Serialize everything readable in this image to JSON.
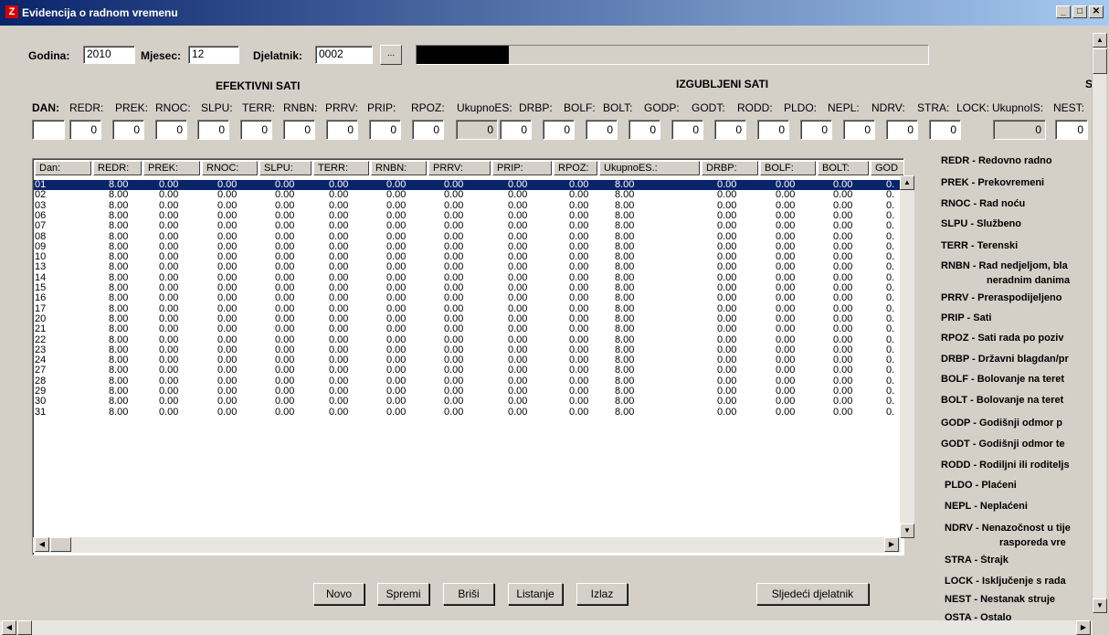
{
  "window": {
    "title": "Evidencija o radnom vremenu",
    "app_icon": "Z"
  },
  "form": {
    "godina_label": "Godina:",
    "godina": "2010",
    "mjesec_label": "Mjesec:",
    "mjesec": "12",
    "djelatnik_label": "Djelatnik:",
    "djelatnik": "0002",
    "browse_label": "...",
    "progress_fraction": 0.18
  },
  "sections": {
    "efektivni": "EFEKTIVNI SATI",
    "izgubljeni": "IZGUBLJENI SATI",
    "third": "S"
  },
  "headers": [
    "DAN:",
    "REDR:",
    "PREK:",
    "RNOC:",
    "SLPU:",
    "TERR:",
    "RNBN:",
    "PRRV:",
    "PRIP:",
    "RPOZ:",
    "UkupnoES:",
    "DRBP:",
    "BOLF:",
    "BOLT:",
    "GODP:",
    "GODT:",
    "RODD:",
    "PLDO:",
    "NEPL:",
    "NDRV:",
    "STRA:",
    "LOCK:",
    "UkupnoIS:",
    "NEST:"
  ],
  "entry_values": [
    "",
    "0",
    "0",
    "0",
    "0",
    "0",
    "0",
    "0",
    "0",
    "0",
    "0",
    "0",
    "0",
    "0",
    "0",
    "0",
    "0",
    "0",
    "0",
    "0",
    "0",
    "0",
    "0",
    "0"
  ],
  "grid": {
    "columns": [
      "Dan:",
      "REDR:",
      "PREK:",
      "RNOC:",
      "SLPU:",
      "TERR:",
      "RNBN:",
      "PRRV:",
      "PRIP:",
      "RPOZ:",
      "UkupnoES.:",
      "DRBP:",
      "BOLF:",
      "BOLT:",
      "GOD"
    ],
    "rows": [
      [
        "01",
        "8.00",
        "0.00",
        "0.00",
        "0.00",
        "0.00",
        "0.00",
        "0.00",
        "0.00",
        "0.00",
        "8.00",
        "0.00",
        "0.00",
        "0.00",
        "0."
      ],
      [
        "02",
        "8.00",
        "0.00",
        "0.00",
        "0.00",
        "0.00",
        "0.00",
        "0.00",
        "0.00",
        "0.00",
        "8.00",
        "0.00",
        "0.00",
        "0.00",
        "0."
      ],
      [
        "03",
        "8.00",
        "0.00",
        "0.00",
        "0.00",
        "0.00",
        "0.00",
        "0.00",
        "0.00",
        "0.00",
        "8.00",
        "0.00",
        "0.00",
        "0.00",
        "0."
      ],
      [
        "06",
        "8.00",
        "0.00",
        "0.00",
        "0.00",
        "0.00",
        "0.00",
        "0.00",
        "0.00",
        "0.00",
        "8.00",
        "0.00",
        "0.00",
        "0.00",
        "0."
      ],
      [
        "07",
        "8.00",
        "0.00",
        "0.00",
        "0.00",
        "0.00",
        "0.00",
        "0.00",
        "0.00",
        "0.00",
        "8.00",
        "0.00",
        "0.00",
        "0.00",
        "0."
      ],
      [
        "08",
        "8.00",
        "0.00",
        "0.00",
        "0.00",
        "0.00",
        "0.00",
        "0.00",
        "0.00",
        "0.00",
        "8.00",
        "0.00",
        "0.00",
        "0.00",
        "0."
      ],
      [
        "09",
        "8.00",
        "0.00",
        "0.00",
        "0.00",
        "0.00",
        "0.00",
        "0.00",
        "0.00",
        "0.00",
        "8.00",
        "0.00",
        "0.00",
        "0.00",
        "0."
      ],
      [
        "10",
        "8.00",
        "0.00",
        "0.00",
        "0.00",
        "0.00",
        "0.00",
        "0.00",
        "0.00",
        "0.00",
        "8.00",
        "0.00",
        "0.00",
        "0.00",
        "0."
      ],
      [
        "13",
        "8.00",
        "0.00",
        "0.00",
        "0.00",
        "0.00",
        "0.00",
        "0.00",
        "0.00",
        "0.00",
        "8.00",
        "0.00",
        "0.00",
        "0.00",
        "0."
      ],
      [
        "14",
        "8.00",
        "0.00",
        "0.00",
        "0.00",
        "0.00",
        "0.00",
        "0.00",
        "0.00",
        "0.00",
        "8.00",
        "0.00",
        "0.00",
        "0.00",
        "0."
      ],
      [
        "15",
        "8.00",
        "0.00",
        "0.00",
        "0.00",
        "0.00",
        "0.00",
        "0.00",
        "0.00",
        "0.00",
        "8.00",
        "0.00",
        "0.00",
        "0.00",
        "0."
      ],
      [
        "16",
        "8.00",
        "0.00",
        "0.00",
        "0.00",
        "0.00",
        "0.00",
        "0.00",
        "0.00",
        "0.00",
        "8.00",
        "0.00",
        "0.00",
        "0.00",
        "0."
      ],
      [
        "17",
        "8.00",
        "0.00",
        "0.00",
        "0.00",
        "0.00",
        "0.00",
        "0.00",
        "0.00",
        "0.00",
        "8.00",
        "0.00",
        "0.00",
        "0.00",
        "0."
      ],
      [
        "20",
        "8.00",
        "0.00",
        "0.00",
        "0.00",
        "0.00",
        "0.00",
        "0.00",
        "0.00",
        "0.00",
        "8.00",
        "0.00",
        "0.00",
        "0.00",
        "0."
      ],
      [
        "21",
        "8.00",
        "0.00",
        "0.00",
        "0.00",
        "0.00",
        "0.00",
        "0.00",
        "0.00",
        "0.00",
        "8.00",
        "0.00",
        "0.00",
        "0.00",
        "0."
      ],
      [
        "22",
        "8.00",
        "0.00",
        "0.00",
        "0.00",
        "0.00",
        "0.00",
        "0.00",
        "0.00",
        "0.00",
        "8.00",
        "0.00",
        "0.00",
        "0.00",
        "0."
      ],
      [
        "23",
        "8.00",
        "0.00",
        "0.00",
        "0.00",
        "0.00",
        "0.00",
        "0.00",
        "0.00",
        "0.00",
        "8.00",
        "0.00",
        "0.00",
        "0.00",
        "0."
      ],
      [
        "24",
        "8.00",
        "0.00",
        "0.00",
        "0.00",
        "0.00",
        "0.00",
        "0.00",
        "0.00",
        "0.00",
        "8.00",
        "0.00",
        "0.00",
        "0.00",
        "0."
      ],
      [
        "27",
        "8.00",
        "0.00",
        "0.00",
        "0.00",
        "0.00",
        "0.00",
        "0.00",
        "0.00",
        "0.00",
        "8.00",
        "0.00",
        "0.00",
        "0.00",
        "0."
      ],
      [
        "28",
        "8.00",
        "0.00",
        "0.00",
        "0.00",
        "0.00",
        "0.00",
        "0.00",
        "0.00",
        "0.00",
        "8.00",
        "0.00",
        "0.00",
        "0.00",
        "0."
      ],
      [
        "29",
        "8.00",
        "0.00",
        "0.00",
        "0.00",
        "0.00",
        "0.00",
        "0.00",
        "0.00",
        "0.00",
        "8.00",
        "0.00",
        "0.00",
        "0.00",
        "0."
      ],
      [
        "30",
        "8.00",
        "0.00",
        "0.00",
        "0.00",
        "0.00",
        "0.00",
        "0.00",
        "0.00",
        "0.00",
        "8.00",
        "0.00",
        "0.00",
        "0.00",
        "0."
      ],
      [
        "31",
        "8.00",
        "0.00",
        "0.00",
        "0.00",
        "0.00",
        "0.00",
        "0.00",
        "0.00",
        "0.00",
        "8.00",
        "0.00",
        "0.00",
        "0.00",
        "0."
      ]
    ]
  },
  "legend": [
    "REDR - Redovno radno",
    "PREK - Prekovremeni",
    "RNOC - Rad noću",
    "SLPU - Službeno",
    "TERR - Terenski",
    "RNBN - Rad nedjeljom, bla",
    "neradnim danima",
    "PRRV - Preraspodijeljeno",
    "PRIP - Sati",
    "RPOZ - Sati rada po poziv",
    "DRBP - Državni blagdan/pr",
    "BOLF - Bolovanje na teret",
    "BOLT - Bolovanje na teret",
    "GODP - Godišnji odmor p",
    "GODT - Godišnji odmor te",
    "RODD - Rodiljni ili roditeljs",
    "PLDO - Plaćeni",
    "NEPL - Neplaćeni",
    "NDRV - Nenazočnost u tije",
    "rasporeda vre",
    "STRA - Štrajk",
    "LOCK - Isključenje s rada",
    "NEST - Nestanak struje",
    "OSTA - Ostalo"
  ],
  "buttons": {
    "novo": "Novo",
    "spremi": "Spremi",
    "brisi": "Briši",
    "listanje": "Listanje",
    "izlaz": "Izlaz",
    "sljedeci": "Sljedeći djelatnik"
  },
  "icons": {
    "minimize": "minimize-icon",
    "maximize": "maximize-icon",
    "close": "close-icon"
  }
}
